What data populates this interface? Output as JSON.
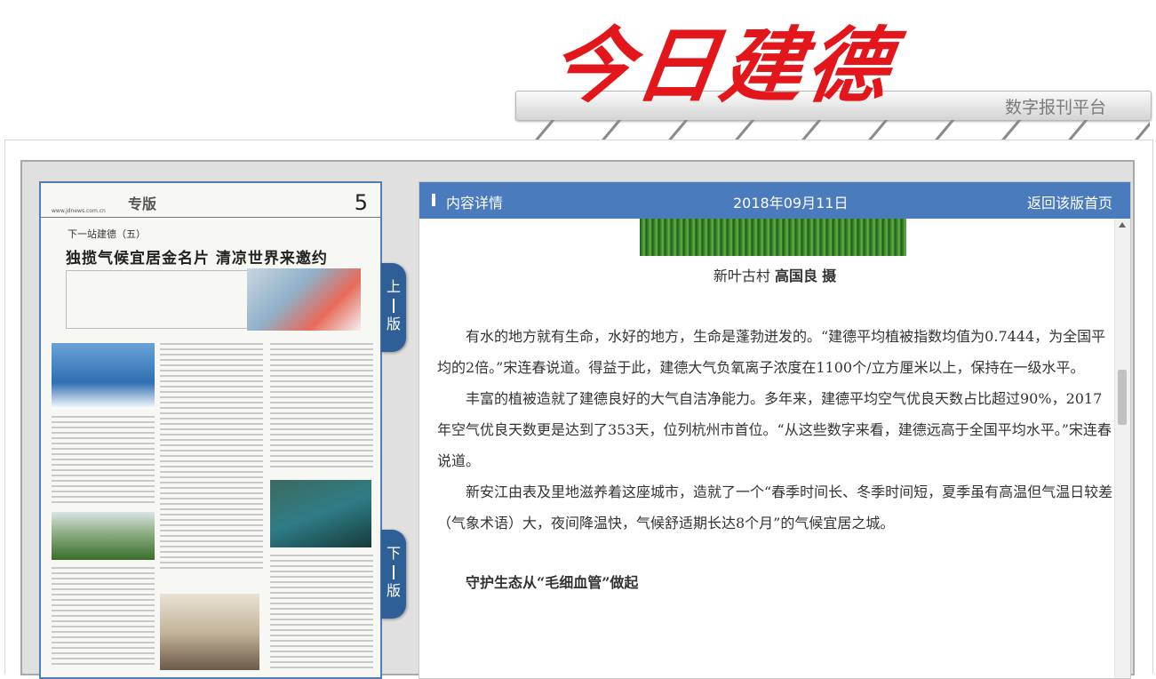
{
  "header": {
    "logo_text": "今日建德",
    "platform_label": "数字报刊平台"
  },
  "paper": {
    "section_label": "专版",
    "page_number": "5",
    "site_url": "www.jdnews.com.cn",
    "kicker": "下一站建德（五）",
    "headline": "独揽气候宜居金名片 清凉世界来邀约"
  },
  "nav": {
    "prev_label": [
      "上",
      "版"
    ],
    "next_label": [
      "下",
      "版"
    ]
  },
  "article": {
    "header_label": "内容详情",
    "date": "2018年09月11日",
    "back_label": "返回该版首页",
    "caption_place": "新叶古村",
    "caption_author": "高国良",
    "caption_suffix": "摄",
    "paragraphs": [
      "有水的地方就有生命，水好的地方，生命是蓬勃迸发的。“建德平均植被指数均值为0.7444，为全国平均的2倍。”宋连春说道。得益于此，建德大气负氧离子浓度在1100个/立方厘米以上，保持在一级水平。",
      "丰富的植被造就了建德良好的大气自洁净能力。多年来，建德平均空气优良天数占比超过90%，2017年空气优良天数更是达到了353天，位列杭州市首位。“从这些数字来看，建德远高于全国平均水平。”宋连春说道。",
      "新安江由表及里地滋养着这座城市，造就了一个“春季时间长、冬季时间短，夏季虽有高温但气温日较差（气象术语）大，夜间降温快，气候舒适期长达8个月”的气候宜居之城。"
    ],
    "subheading": "守护生态从“毛细血管”做起"
  }
}
